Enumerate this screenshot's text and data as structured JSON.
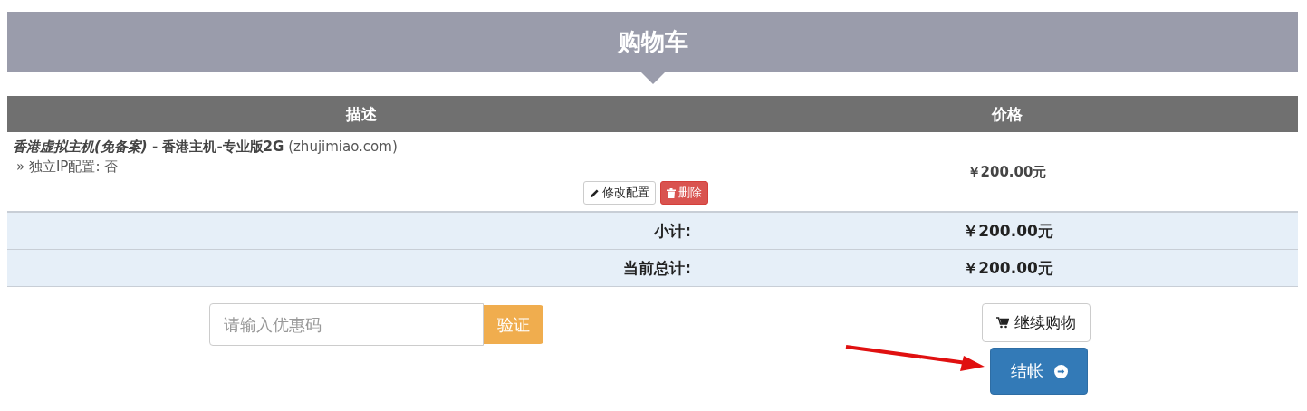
{
  "header": {
    "title": "购物车"
  },
  "table": {
    "columns": [
      "描述",
      "价格"
    ],
    "rows": [
      {
        "product_group": "香港虚拟主机(免备案)",
        "separator": " - ",
        "product_name": "香港主机-专业版2G",
        "domain": "(zhujimiao.com)",
        "options": [
          "» 独立IP配置: 否"
        ],
        "price": "￥200.00元",
        "actions": [
          {
            "kind": "edit",
            "label": "修改配置"
          },
          {
            "kind": "delete",
            "label": "删除"
          }
        ]
      }
    ]
  },
  "totals": [
    {
      "label": "小计:",
      "value": "￥200.00元"
    },
    {
      "label": "当前总计:",
      "value": "￥200.00元"
    }
  ],
  "coupon": {
    "placeholder": "请输入优惠码",
    "button": "验证"
  },
  "continue_button": "继续购物",
  "checkout_button": "结帐"
}
